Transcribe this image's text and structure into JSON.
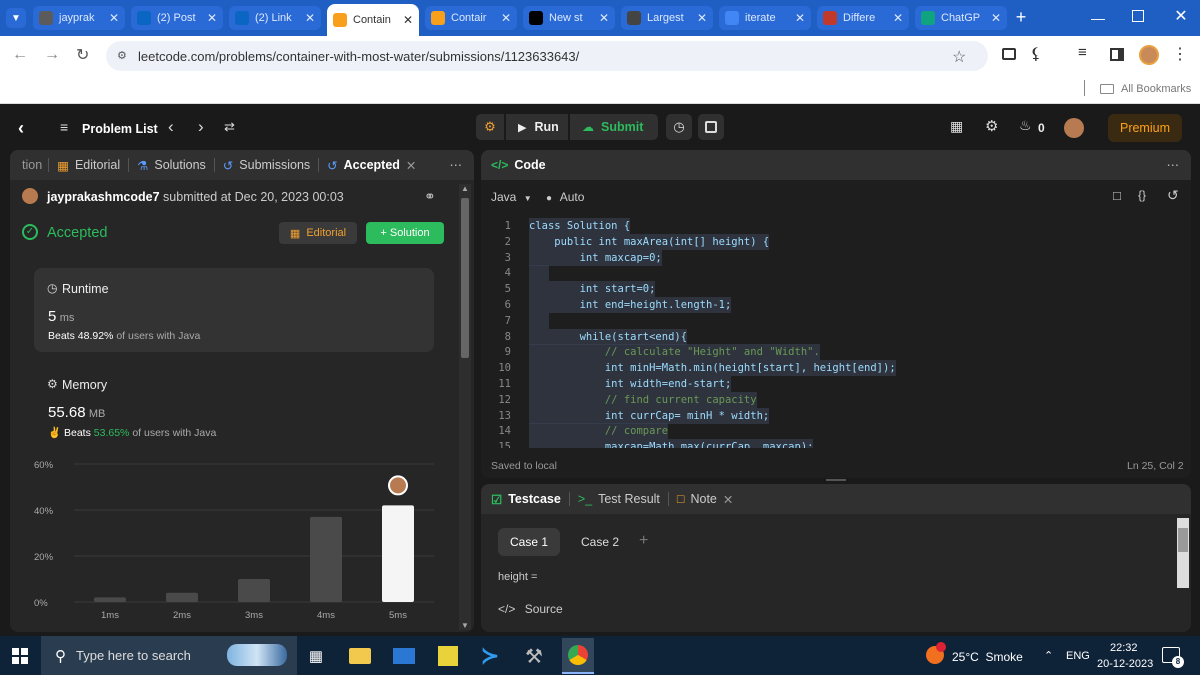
{
  "browser": {
    "tabs": [
      {
        "label": "jayprak",
        "icon": "github-icon",
        "color": "#5b5b5b"
      },
      {
        "label": "(2) Post",
        "icon": "linkedin-icon",
        "color": "#0a66c2"
      },
      {
        "label": "(2) Link",
        "icon": "linkedin-icon",
        "color": "#0a66c2"
      },
      {
        "label": "Contain",
        "icon": "leetcode-icon",
        "color": "#f89f1b"
      },
      {
        "label": "Contair",
        "icon": "leetcode-icon",
        "color": "#f89f1b"
      },
      {
        "label": "New st",
        "icon": "medium-icon",
        "color": "#000000"
      },
      {
        "label": "Largest",
        "icon": "copilot-icon",
        "color": "#444444"
      },
      {
        "label": "iterate",
        "icon": "google-icon",
        "color": "#4285f4"
      },
      {
        "label": "Differe",
        "icon": "gfg-icon",
        "color": "#c0392b"
      },
      {
        "label": "ChatGP",
        "icon": "chatgpt-icon",
        "color": "#10a37f"
      }
    ],
    "url": "leetcode.com/problems/container-with-most-water/submissions/1123633643/",
    "bookmarks_label": "All Bookmarks"
  },
  "nav": {
    "problem_list": "Problem List",
    "run": "Run",
    "submit": "Submit",
    "streak": "0",
    "premium": "Premium"
  },
  "left": {
    "tabs": {
      "partial": "tion",
      "editorial": "Editorial",
      "solutions": "Solutions",
      "submissions": "Submissions",
      "accepted": "Accepted"
    },
    "user": "jayprakashmcode7",
    "submitted_text": "submitted at Dec 20, 2023 00:03",
    "status": "Accepted",
    "editorial_btn": "Editorial",
    "solution_btn": "+ Solution",
    "runtime": {
      "label": "Runtime",
      "value": "5",
      "unit": "ms",
      "beats_prefix": "Beats",
      "beats_value": "48.92%",
      "beats_suffix": "of users with Java"
    },
    "memory": {
      "label": "Memory",
      "value": "55.68",
      "unit": "MB",
      "beats_prefix": "Beats",
      "beats_value": "53.65%",
      "beats_suffix": "of users with Java"
    }
  },
  "chart_data": {
    "type": "bar",
    "categories": [
      "1ms",
      "2ms",
      "3ms",
      "4ms",
      "5ms"
    ],
    "values": [
      2,
      4,
      10,
      37,
      42
    ],
    "y_ticks": [
      "60%",
      "40%",
      "20%",
      "0%"
    ],
    "ylim": [
      0,
      60
    ],
    "highlight": "5ms"
  },
  "code": {
    "title": "Code",
    "language": "Java",
    "mode": "Auto",
    "saved": "Saved to local",
    "cursor": "Ln 25, Col 2",
    "lines": [
      {
        "n": "1",
        "text": "class Solution {"
      },
      {
        "n": "2",
        "text": "    public int maxArea(int[] height) {"
      },
      {
        "n": "3",
        "text": "        int maxcap=0;"
      },
      {
        "n": "4",
        "text": ""
      },
      {
        "n": "5",
        "text": "        int start=0;"
      },
      {
        "n": "6",
        "text": "        int end=height.length-1;"
      },
      {
        "n": "7",
        "text": ""
      },
      {
        "n": "8",
        "text": "        while(start<end){"
      },
      {
        "n": "9",
        "text": "            // calculate \"Height\" and \"Width\"."
      },
      {
        "n": "10",
        "text": "            int minH=Math.min(height[start], height[end]);"
      },
      {
        "n": "11",
        "text": "            int width=end-start;"
      },
      {
        "n": "12",
        "text": "            // find current capacity"
      },
      {
        "n": "13",
        "text": "            int currCap= minH * width;"
      },
      {
        "n": "14",
        "text": "            // compare"
      },
      {
        "n": "15",
        "text": "            maxcap=Math.max(currCap, maxcap);"
      }
    ]
  },
  "bottom": {
    "testcase": "Testcase",
    "test_result": "Test Result",
    "note": "Note",
    "case1": "Case 1",
    "case2": "Case 2",
    "height_label": "height =",
    "source": "Source"
  },
  "taskbar": {
    "search_placeholder": "Type here to search",
    "weather": "25°C  Smoke",
    "lang": "ENG",
    "time": "22:32",
    "date": "20-12-2023",
    "notif": "8"
  }
}
